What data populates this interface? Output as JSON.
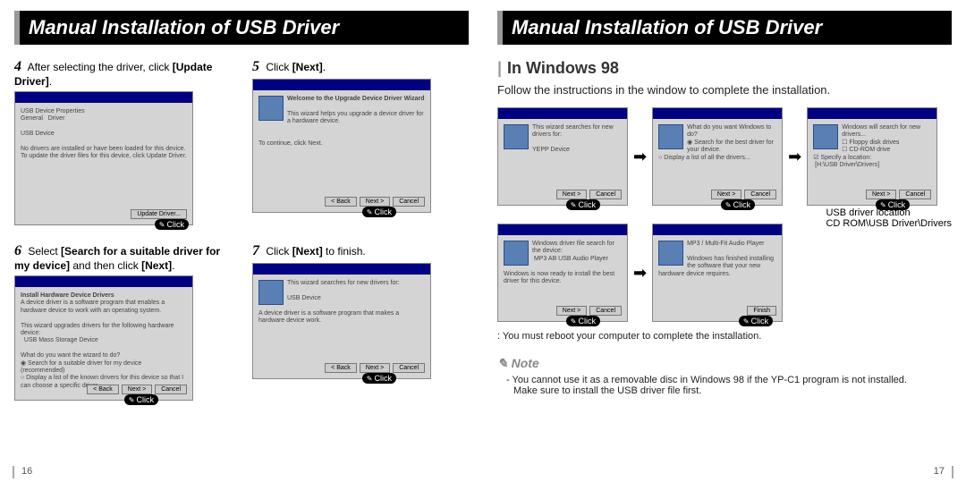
{
  "titlebar_left": "Manual Installation of USB Driver",
  "titlebar_right": "Manual Installation of USB Driver",
  "left": {
    "step4": {
      "num": "4",
      "text_a": "After selecting the driver, click ",
      "bold_a": "[Update Driver]",
      "text_b": "."
    },
    "step5": {
      "num": "5",
      "text_a": "Click ",
      "bold_a": "[Next]",
      "text_b": "."
    },
    "step6": {
      "num": "6",
      "text_a": "Select  ",
      "bold_a": "[Search for a suitable driver for my device]",
      "text_b": " and then click ",
      "bold_b": "[Next]",
      "text_c": "."
    },
    "step7": {
      "num": "7",
      "text_a": "Click ",
      "bold_a": "[Next]",
      "text_b": " to finish."
    }
  },
  "right": {
    "heading": "In Windows 98",
    "intro": "Follow the instructions in the window to complete the installation.",
    "driver_loc_label": "USB driver location",
    "driver_loc_path": "CD ROM\\USB Driver\\Drivers",
    "reboot": "You must reboot your computer to complete the installation.",
    "note_title": "Note",
    "note_line1": "- You cannot use it as a removable disc in Windows 98 if the YP-C1 program is not installed.",
    "note_line2": "Make sure to install the USB driver file first."
  },
  "click_label": "Click",
  "page_left": "16",
  "page_right": "17"
}
